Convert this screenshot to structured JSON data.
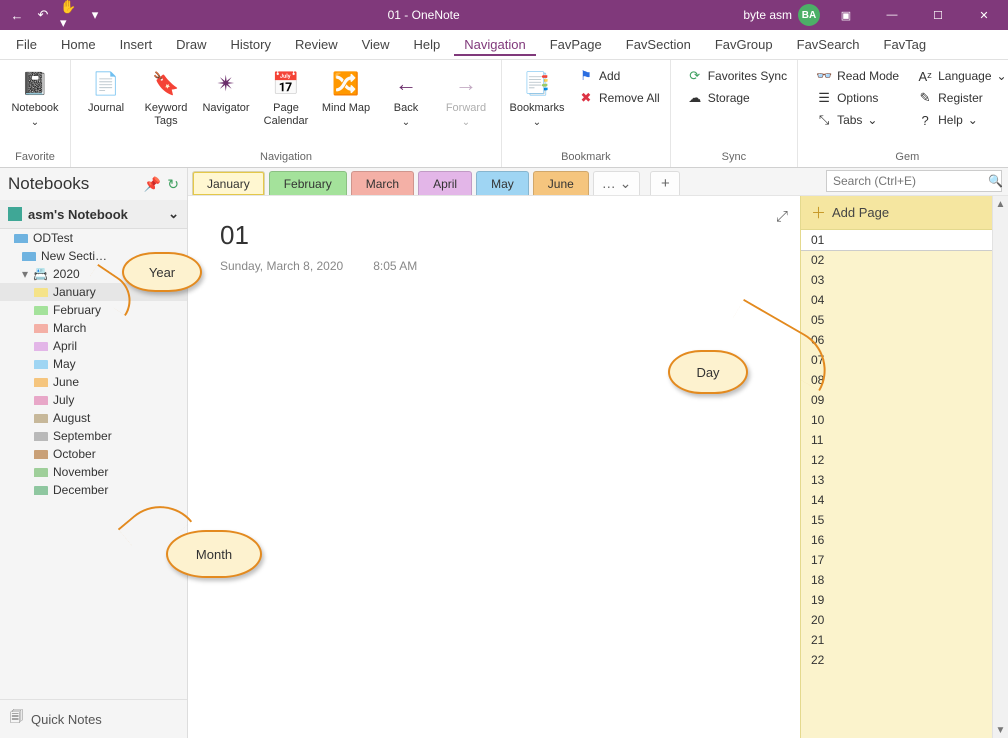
{
  "titlebar": {
    "title": "01  -  OneNote",
    "user_name": "byte asm",
    "avatar_initials": "BA"
  },
  "menubar": {
    "items": [
      "File",
      "Home",
      "Insert",
      "Draw",
      "History",
      "Review",
      "View",
      "Help",
      "Navigation",
      "FavPage",
      "FavSection",
      "FavGroup",
      "FavSearch",
      "FavTag"
    ],
    "active": "Navigation"
  },
  "ribbon": {
    "groups": [
      {
        "label": "Favorite",
        "big": [
          {
            "name": "Notebook",
            "chev": true
          }
        ]
      },
      {
        "label": "Navigation",
        "big": [
          {
            "name": "Journal"
          },
          {
            "name": "Keyword Tags"
          },
          {
            "name": "Navigator"
          },
          {
            "name": "Page Calendar"
          },
          {
            "name": "Mind Map"
          },
          {
            "name": "Back",
            "chev": true
          },
          {
            "name": "Forward",
            "chev": true,
            "disabled": true
          }
        ]
      },
      {
        "label": "Bookmark",
        "big": [
          {
            "name": "Bookmarks",
            "chev": true
          }
        ],
        "small": [
          {
            "name": "Add",
            "icon": "flag"
          },
          {
            "name": "Remove All",
            "icon": "x"
          }
        ]
      },
      {
        "label": "Sync",
        "small": [
          {
            "name": "Favorites Sync",
            "icon": "sync"
          },
          {
            "name": "Storage",
            "icon": "storage"
          }
        ]
      },
      {
        "label": "Gem",
        "small_cols": [
          [
            {
              "name": "Read Mode",
              "icon": "read"
            },
            {
              "name": "Options",
              "icon": "options"
            },
            {
              "name": "Tabs",
              "icon": "tabs",
              "chev": true
            }
          ],
          [
            {
              "name": "Language",
              "icon": "lang",
              "chev": true
            },
            {
              "name": "Register",
              "icon": "reg"
            },
            {
              "name": "Help",
              "icon": "help",
              "chev": true
            }
          ]
        ]
      }
    ]
  },
  "sidebar": {
    "title": "Notebooks",
    "notebook": "asm's Notebook",
    "tree": [
      {
        "label": "ODTest",
        "type": "section",
        "color": "sw-blue"
      },
      {
        "label": "New Secti…",
        "type": "section",
        "color": "sw-blue",
        "level": 1
      },
      {
        "label": "2020",
        "type": "group",
        "level": 1
      },
      {
        "label": "January",
        "level": 2,
        "color": "c-jan",
        "sel": true
      },
      {
        "label": "February",
        "level": 2,
        "color": "c-feb"
      },
      {
        "label": "March",
        "level": 2,
        "color": "c-mar"
      },
      {
        "label": "April",
        "level": 2,
        "color": "c-apr"
      },
      {
        "label": "May",
        "level": 2,
        "color": "c-may"
      },
      {
        "label": "June",
        "level": 2,
        "color": "c-jun"
      },
      {
        "label": "July",
        "level": 2,
        "color": "c-jul"
      },
      {
        "label": "August",
        "level": 2,
        "color": "c-aug"
      },
      {
        "label": "September",
        "level": 2,
        "color": "c-sep"
      },
      {
        "label": "October",
        "level": 2,
        "color": "c-oct"
      },
      {
        "label": "November",
        "level": 2,
        "color": "c-nov"
      },
      {
        "label": "December",
        "level": 2,
        "color": "c-dec"
      }
    ],
    "quick": "Quick Notes"
  },
  "tabs": {
    "items": [
      {
        "label": "January",
        "color": "active"
      },
      {
        "label": "February",
        "color": "c-feb"
      },
      {
        "label": "March",
        "color": "c-mar"
      },
      {
        "label": "April",
        "color": "c-apr"
      },
      {
        "label": "May",
        "color": "c-may"
      },
      {
        "label": "June",
        "color": "c-jun"
      }
    ],
    "more": "…",
    "search_placeholder": "Search (Ctrl+E)"
  },
  "page": {
    "title": "01",
    "date": "Sunday, March 8, 2020",
    "time": "8:05 AM"
  },
  "pagerail": {
    "add": "Add Page",
    "items": [
      "01",
      "02",
      "03",
      "04",
      "05",
      "06",
      "07",
      "08",
      "09",
      "10",
      "11",
      "12",
      "13",
      "14",
      "15",
      "16",
      "17",
      "18",
      "19",
      "20",
      "21",
      "22"
    ],
    "selected": "01"
  },
  "callouts": {
    "year": "Year",
    "month": "Month",
    "day": "Day"
  }
}
